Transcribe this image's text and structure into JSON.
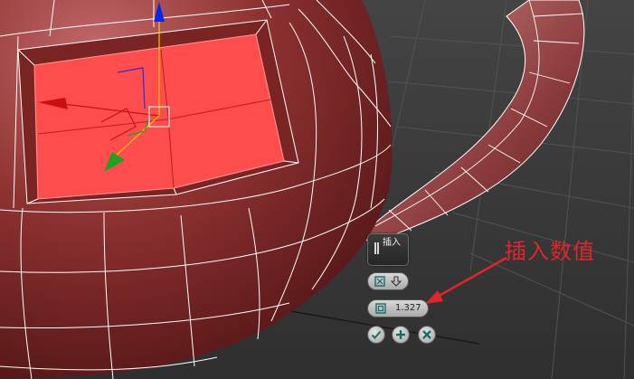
{
  "caddy": {
    "title": "插入",
    "amount_value": "1.327",
    "buttons": {
      "mode_icon": "group-mode-icon",
      "dropdown_icon": "down-arrow-icon",
      "amount_icon": "inset-amount-icon",
      "ok_icon": "checkmark-icon",
      "apply_icon": "plus-icon",
      "cancel_icon": "x-icon"
    }
  },
  "annotation": {
    "text": "插入数值",
    "color": "#e0262a"
  },
  "colors": {
    "mesh": "#8a2f2f",
    "selected_polygon": "#ff4c4c",
    "wireframe": "#ffffff",
    "background": "#3a3a3a",
    "gizmo_y": "#1fa21f",
    "gizmo_z": "#0a25e8",
    "gizmo_x": "#cc1010"
  }
}
